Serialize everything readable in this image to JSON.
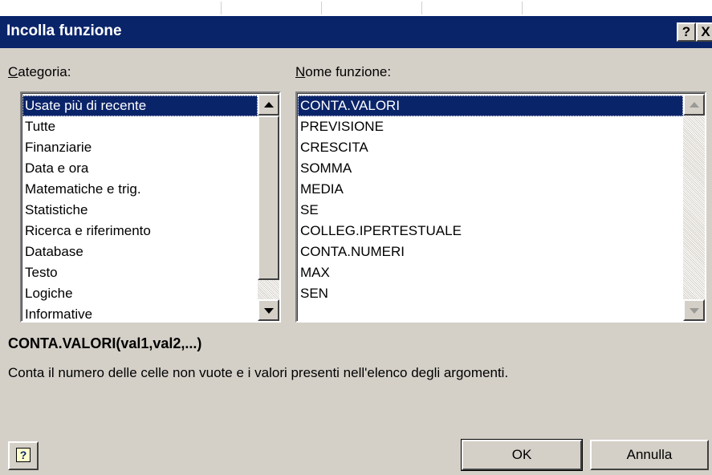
{
  "dialog": {
    "title": "Incolla funzione",
    "help_glyph": "?",
    "close_glyph": "X"
  },
  "categoria": {
    "label_underline": "C",
    "label_rest": "ategoria:",
    "items": [
      "Usate più di recente",
      "Tutte",
      "Finanziarie",
      "Data e ora",
      "Matematiche e trig.",
      "Statistiche",
      "Ricerca e riferimento",
      "Database",
      "Testo",
      "Logiche",
      "Informative"
    ],
    "selected": "Usate più di recente"
  },
  "funzioni": {
    "label_underline": "N",
    "label_rest": "ome funzione:",
    "items": [
      "CONTA.VALORI",
      "PREVISIONE",
      "CRESCITA",
      "SOMMA",
      "MEDIA",
      "SE",
      "COLLEG.IPERTESTUALE",
      "CONTA.NUMERI",
      "MAX",
      "SEN"
    ],
    "selected": "CONTA.VALORI"
  },
  "signature": "CONTA.VALORI(val1,val2,...)",
  "description": "Conta il numero delle celle non vuote e i valori presenti nell'elenco degli argomenti.",
  "buttons": {
    "ok": "OK",
    "cancel": "Annulla",
    "office_assistant_glyph": "?"
  },
  "icons": {
    "help": "question-mark-icon",
    "close": "close-icon",
    "assistant": "office-assistant-icon",
    "scroll_up": "scroll-up-arrow-icon",
    "scroll_down": "scroll-down-arrow-icon"
  }
}
